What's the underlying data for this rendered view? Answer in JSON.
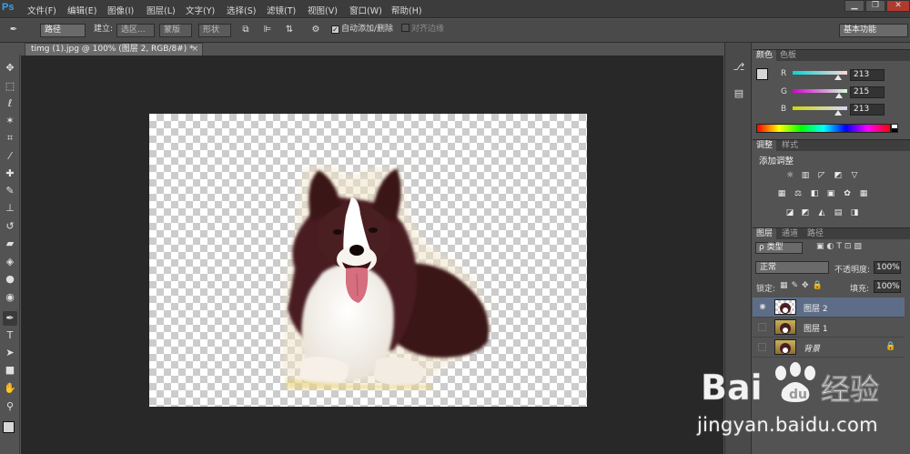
{
  "app": {
    "logo": "Ps"
  },
  "menu": [
    "文件(F)",
    "编辑(E)",
    "图像(I)",
    "图层(L)",
    "文字(Y)",
    "选择(S)",
    "滤镜(T)",
    "视图(V)",
    "窗口(W)",
    "帮助(H)"
  ],
  "window_controls": {
    "minimize": "▁",
    "restore": "❐",
    "close": "✕"
  },
  "options": {
    "mode": "路径",
    "make_label": "建立:",
    "selection": "选区...",
    "mask": "蒙版",
    "shape": "形状",
    "auto_add_delete": "自动添加/删除",
    "align_edges": "对齐边缘",
    "workspace": "基本功能"
  },
  "document": {
    "tab_title": "timg (1).jpg @ 100% (图层 2, RGB/8#) *",
    "close": "×"
  },
  "color_panel": {
    "tabs": [
      "颜色",
      "色板"
    ],
    "r_label": "R",
    "g_label": "G",
    "b_label": "B",
    "r": "213",
    "g": "215",
    "b": "213",
    "r_level": 0.835,
    "g_level": 0.843,
    "b_level": 0.835
  },
  "adjustments_panel": {
    "tabs": [
      "调整",
      "样式"
    ],
    "title": "添加调整"
  },
  "layers_panel": {
    "tabs": [
      "图层",
      "通道",
      "路径"
    ],
    "kind_filter": "ρ 类型",
    "blend_mode": "正常",
    "opacity_label": "不透明度:",
    "opacity": "100%",
    "lock_label": "锁定:",
    "fill_label": "填充:",
    "fill": "100%",
    "layers": [
      {
        "name": "图层 2",
        "visible": true,
        "selected": true
      },
      {
        "name": "图层 1",
        "visible": false,
        "selected": false
      },
      {
        "name": "背景",
        "visible": false,
        "selected": false,
        "locked": true
      }
    ]
  },
  "colors": {
    "accent_blue": "#3aa0e8",
    "selected_layer": "#5d6d88",
    "canvas_bg": "#282828"
  },
  "watermark": {
    "logo_text": "Bai",
    "logo_text2": "经验",
    "url": "jingyan.baidu.com"
  }
}
